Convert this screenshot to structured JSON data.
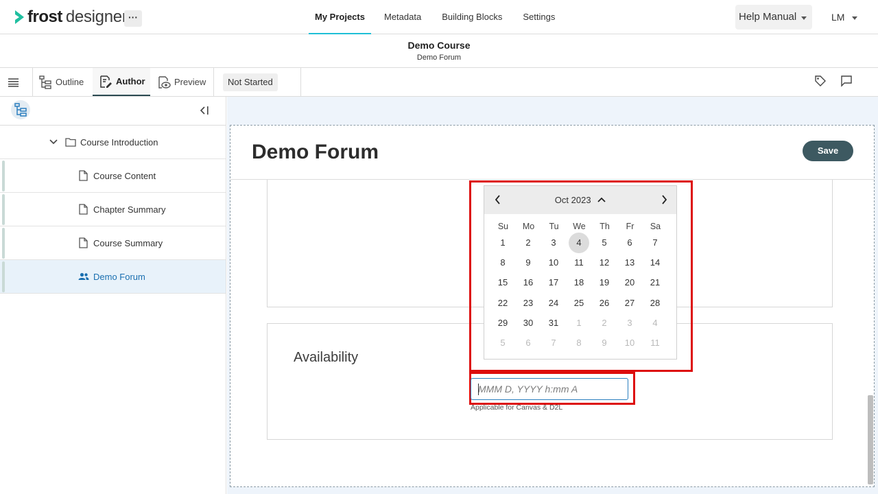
{
  "brand": {
    "word1": "frost",
    "word2": "designer",
    "more_label": "···"
  },
  "nav": {
    "links": [
      "My Projects",
      "Metadata",
      "Building Blocks",
      "Settings"
    ],
    "help_label": "Help Manual",
    "user_initials": "LM"
  },
  "course": {
    "title": "Demo Course",
    "subtitle": "Demo Forum"
  },
  "toolbar": {
    "outline": "Outline",
    "author": "Author",
    "preview": "Preview",
    "status": "Not Started"
  },
  "sidebar": {
    "folder": "Course Introduction",
    "items": [
      {
        "label": "Course Content",
        "icon": "document-icon"
      },
      {
        "label": "Chapter Summary",
        "icon": "document-icon"
      },
      {
        "label": "Course Summary",
        "icon": "document-icon"
      },
      {
        "label": "Demo Forum",
        "icon": "people-icon",
        "active": true
      }
    ]
  },
  "editor": {
    "title": "Demo Forum",
    "save_label": "Save",
    "availability_label": "Availability",
    "date_placeholder": "MMM D, YYYY h:mm A",
    "date_help": "Applicable for Canvas & D2L"
  },
  "datepicker": {
    "month_label": "Oct 2023",
    "weekdays": [
      "Su",
      "Mo",
      "Tu",
      "We",
      "Th",
      "Fr",
      "Sa"
    ],
    "weeks": [
      [
        [
          "1",
          0
        ],
        [
          "2",
          0
        ],
        [
          "3",
          0
        ],
        [
          "4",
          2
        ],
        [
          "5",
          0
        ],
        [
          "6",
          0
        ],
        [
          "7",
          0
        ]
      ],
      [
        [
          "8",
          0
        ],
        [
          "9",
          0
        ],
        [
          "10",
          0
        ],
        [
          "11",
          0
        ],
        [
          "12",
          0
        ],
        [
          "13",
          0
        ],
        [
          "14",
          0
        ]
      ],
      [
        [
          "15",
          0
        ],
        [
          "16",
          0
        ],
        [
          "17",
          0
        ],
        [
          "18",
          0
        ],
        [
          "19",
          0
        ],
        [
          "20",
          0
        ],
        [
          "21",
          0
        ]
      ],
      [
        [
          "22",
          0
        ],
        [
          "23",
          0
        ],
        [
          "24",
          0
        ],
        [
          "25",
          0
        ],
        [
          "26",
          0
        ],
        [
          "27",
          0
        ],
        [
          "28",
          0
        ]
      ],
      [
        [
          "29",
          0
        ],
        [
          "30",
          0
        ],
        [
          "31",
          0
        ],
        [
          "1",
          1
        ],
        [
          "2",
          1
        ],
        [
          "3",
          1
        ],
        [
          "4",
          1
        ]
      ],
      [
        [
          "5",
          1
        ],
        [
          "6",
          1
        ],
        [
          "7",
          1
        ],
        [
          "8",
          1
        ],
        [
          "9",
          1
        ],
        [
          "10",
          1
        ],
        [
          "11",
          1
        ]
      ]
    ],
    "highlight_color": "#dd0d0d"
  },
  "colors": {
    "accent": "#1fbfd6",
    "save_bg": "#3d5961",
    "active_link": "#1a6fb0"
  }
}
